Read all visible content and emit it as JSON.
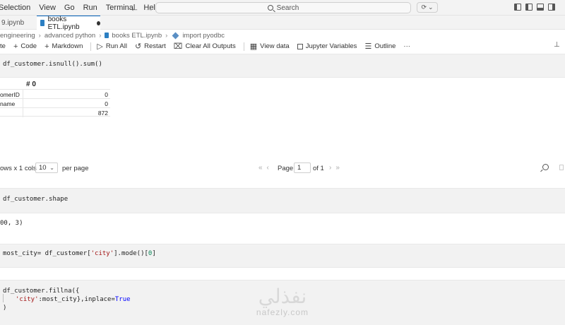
{
  "menu": [
    "Selection",
    "View",
    "Go",
    "Run",
    "Terminal",
    "Help"
  ],
  "search": {
    "label": "Search"
  },
  "tabs": [
    {
      "label": "9.ipynb"
    },
    {
      "label": "books ETL.ipynb"
    }
  ],
  "breadcrumb": [
    "engineering",
    "advanced python",
    "books ETL.ipynb",
    "import pyodbc"
  ],
  "toolbar": {
    "code_partial": "te",
    "add_code": "Code",
    "add_markdown": "Markdown",
    "run_all": "Run All",
    "restart": "Restart",
    "clear_outputs": "Clear All Outputs",
    "view_data": "View data",
    "jupyter_variables": "Jupyter Variables",
    "outline": "Outline",
    "more": "···"
  },
  "cells": {
    "cell1": "df_customer.isnull().sum()",
    "cell2": "df_customer.shape",
    "cell2_output": "00, 3)",
    "cell3_prefix": "most_city= df_customer[",
    "cell3_str": "'city'",
    "cell3_mid": "].mode()[",
    "cell3_num": "0",
    "cell3_end": "]",
    "cell4_line1": "df_customer.fillna({",
    "cell4_str": "'city'",
    "cell4_line2": ":most_city},inplace=",
    "cell4_kw": "True",
    "cell4_line3": ")"
  },
  "output_table": {
    "header": "# 0",
    "rows": [
      {
        "index": "omerID",
        "value": "0"
      },
      {
        "index": "name",
        "value": "0"
      },
      {
        "index": "",
        "value": "872"
      }
    ]
  },
  "pager": {
    "rows_cols": "ows x 1 cols",
    "page_size": "10",
    "per_page": "per page",
    "page_label": "Page",
    "page_value": "1",
    "of_label": "of 1"
  },
  "watermark": {
    "arabic": "نفذلي",
    "latin": "nafezly.com"
  }
}
